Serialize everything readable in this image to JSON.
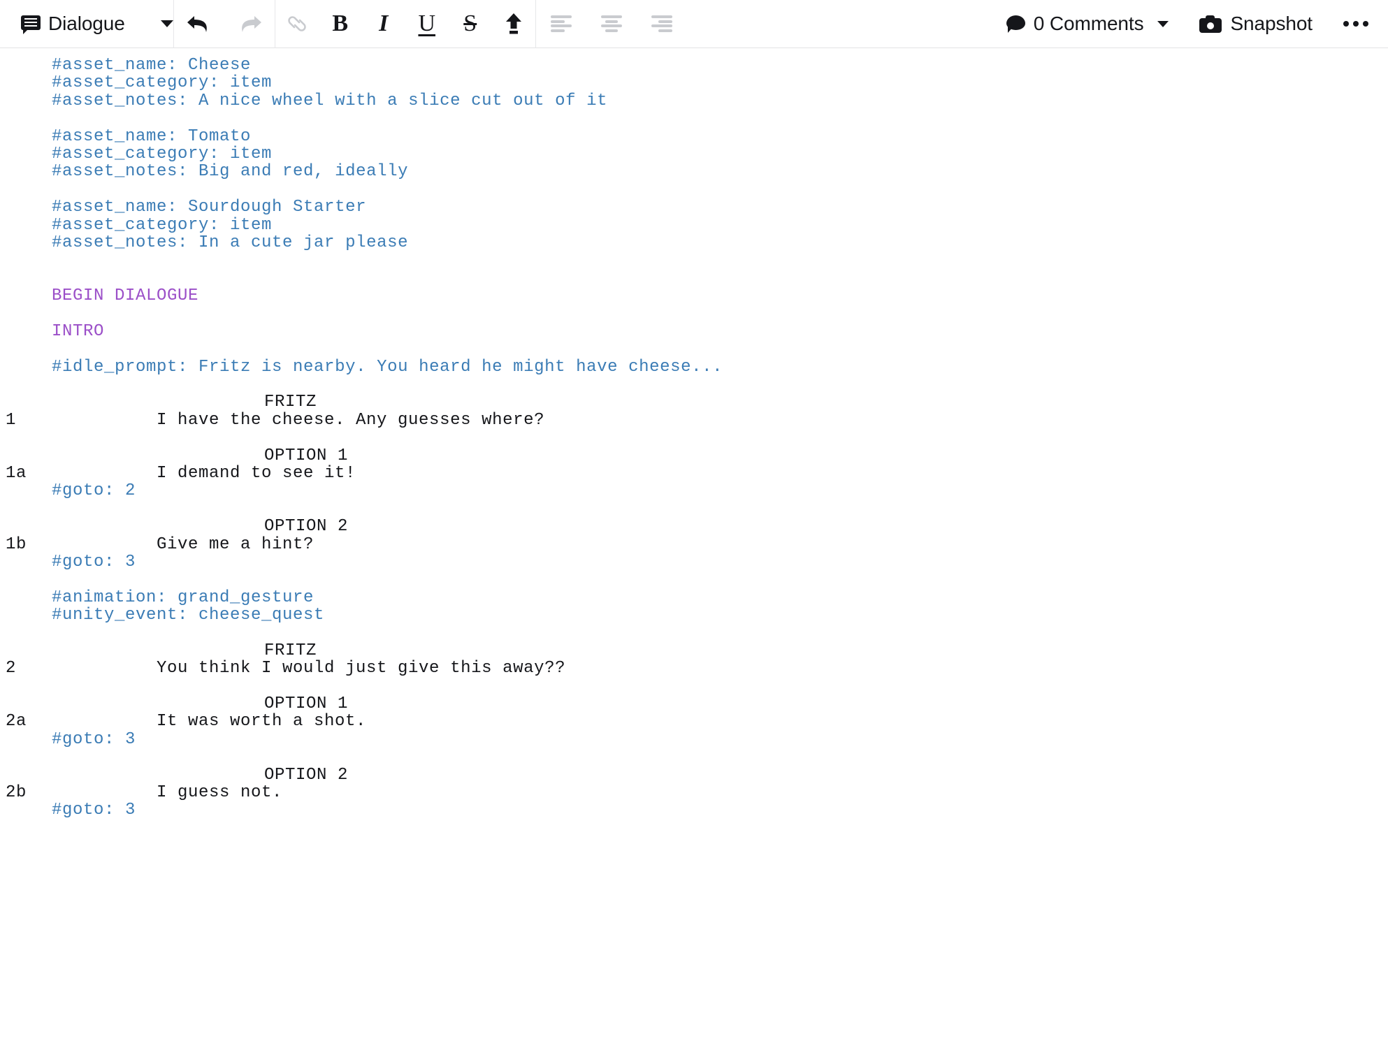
{
  "toolbar": {
    "doc_type": "Dialogue",
    "doc_type_icon": "dialogue-chat-icon",
    "caret_icon": "chevron-down-icon",
    "undo_icon": "undo-arrow-icon",
    "redo_icon": "redo-arrow-icon",
    "link_icon": "link-icon",
    "bold_label": "B",
    "italic_label": "I",
    "underline_label": "U",
    "strikethrough_label": "S",
    "upload_icon": "upload-arrow-icon",
    "align_left_icon": "align-left-icon",
    "align_center_icon": "align-center-icon",
    "align_right_icon": "align-right-icon",
    "comments_label": "0 Comments",
    "comments_icon": "comment-bubble-icon",
    "snapshot_label": "Snapshot",
    "snapshot_icon": "camera-icon",
    "more_icon": "more-options-icon"
  },
  "colors": {
    "tag_blue": "#3b7cb5",
    "heading_purple": "#9b4fc8",
    "text_black": "#15161a",
    "toolbar_border": "#e2e3e5",
    "disabled_gray": "#c9cbcf"
  },
  "document": {
    "lines": [
      {
        "kind": "tag",
        "text": "#asset_name: Cheese"
      },
      {
        "kind": "tag",
        "text": "#asset_category: item"
      },
      {
        "kind": "tag",
        "text": "#asset_notes: A nice wheel with a slice cut out of it"
      },
      {
        "kind": "blank",
        "text": ""
      },
      {
        "kind": "tag",
        "text": "#asset_name: Tomato"
      },
      {
        "kind": "tag",
        "text": "#asset_category: item"
      },
      {
        "kind": "tag",
        "text": "#asset_notes: Big and red, ideally"
      },
      {
        "kind": "blank",
        "text": ""
      },
      {
        "kind": "tag",
        "text": "#asset_name: Sourdough Starter"
      },
      {
        "kind": "tag",
        "text": "#asset_category: item"
      },
      {
        "kind": "tag",
        "text": "#asset_notes: In a cute jar please"
      },
      {
        "kind": "blank",
        "text": ""
      },
      {
        "kind": "blank",
        "text": ""
      },
      {
        "kind": "head",
        "text": "BEGIN DIALOGUE"
      },
      {
        "kind": "blank",
        "text": ""
      },
      {
        "kind": "head",
        "text": "INTRO"
      },
      {
        "kind": "blank",
        "text": ""
      },
      {
        "kind": "tag",
        "text": "#idle_prompt: Fritz is nearby. You heard he might have cheese..."
      },
      {
        "kind": "blank",
        "text": ""
      },
      {
        "kind": "char",
        "text": "FRITZ"
      },
      {
        "kind": "dialog",
        "text": "I have the cheese. Any guesses where?",
        "num": "1"
      },
      {
        "kind": "blank",
        "text": ""
      },
      {
        "kind": "char",
        "text": "OPTION 1"
      },
      {
        "kind": "dialog",
        "text": "I demand to see it!",
        "num": "1a"
      },
      {
        "kind": "goto",
        "text": "#goto: 2"
      },
      {
        "kind": "blank",
        "text": ""
      },
      {
        "kind": "char",
        "text": "OPTION 2"
      },
      {
        "kind": "dialog",
        "text": "Give me a hint?",
        "num": "1b"
      },
      {
        "kind": "goto",
        "text": "#goto: 3"
      },
      {
        "kind": "blank",
        "text": ""
      },
      {
        "kind": "tag",
        "text": "#animation: grand_gesture"
      },
      {
        "kind": "tag",
        "text": "#unity_event: cheese_quest"
      },
      {
        "kind": "blank",
        "text": ""
      },
      {
        "kind": "char",
        "text": "FRITZ"
      },
      {
        "kind": "dialog",
        "text": "You think I would just give this away??",
        "num": "2"
      },
      {
        "kind": "blank",
        "text": ""
      },
      {
        "kind": "char",
        "text": "OPTION 1"
      },
      {
        "kind": "dialog",
        "text": "It was worth a shot.",
        "num": "2a"
      },
      {
        "kind": "goto",
        "text": "#goto: 3"
      },
      {
        "kind": "blank",
        "text": ""
      },
      {
        "kind": "char",
        "text": "OPTION 2"
      },
      {
        "kind": "dialog",
        "text": "I guess not.",
        "num": "2b"
      },
      {
        "kind": "goto",
        "text": "#goto: 3"
      }
    ]
  }
}
